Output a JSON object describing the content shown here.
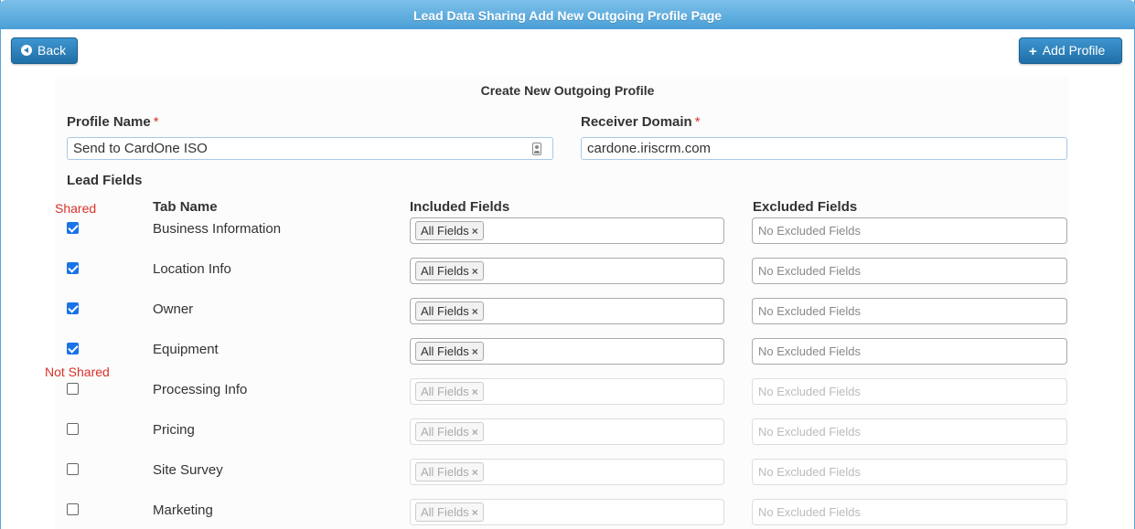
{
  "window": {
    "title": "Lead Data Sharing Add New Outgoing Profile Page"
  },
  "toolbar": {
    "back_label": "Back",
    "add_label": "Add Profile",
    "add_icon": "+"
  },
  "form": {
    "title": "Create New Outgoing Profile",
    "profile_name_label": "Profile Name",
    "profile_name_value": "Send to CardOne ISO",
    "receiver_domain_label": "Receiver Domain",
    "receiver_domain_value": "cardone.iriscrm.com",
    "required_mark": "*"
  },
  "lead_fields": {
    "section_label": "Lead Fields",
    "shared_label": "Shared",
    "not_shared_label": "Not Shared",
    "columns": {
      "tab_name": "Tab Name",
      "included": "Included Fields",
      "excluded": "Excluded Fields"
    },
    "tag_label": "All Fields",
    "tag_remove": "×",
    "excluded_placeholder": "No Excluded Fields",
    "rows": [
      {
        "name": "Business Information",
        "shared": true
      },
      {
        "name": "Location Info",
        "shared": true
      },
      {
        "name": "Owner",
        "shared": true
      },
      {
        "name": "Equipment",
        "shared": true
      },
      {
        "name": "Processing Info",
        "shared": false
      },
      {
        "name": "Pricing",
        "shared": false
      },
      {
        "name": "Site Survey",
        "shared": false
      },
      {
        "name": "Marketing",
        "shared": false
      }
    ]
  }
}
